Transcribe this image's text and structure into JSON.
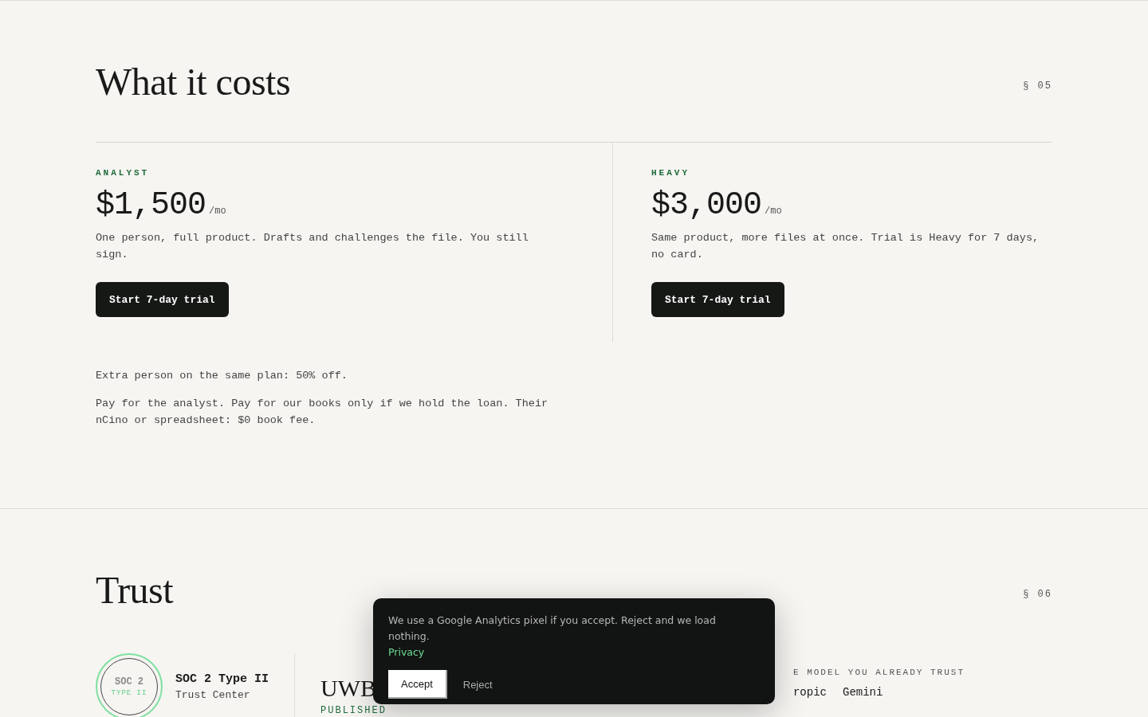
{
  "pricing": {
    "title": "What it costs",
    "section_number": "§ 05",
    "plans": [
      {
        "name": "ANALYST",
        "price": "$1,500",
        "period": "/mo",
        "description": "One person, full product. Drafts and challenges the file. You still sign.",
        "button": "Start 7-day trial"
      },
      {
        "name": "HEAVY",
        "price": "$3,000",
        "period": "/mo",
        "description": "Same product, more files at once. Trial is Heavy for 7 days, no card.",
        "button": "Start 7-day trial"
      }
    ],
    "notes": [
      "Extra person on the same plan: 50% off.",
      "Pay for the analyst. Pay for our books only if we hold the loan. Their nCino or spreadsheet: $0 book fee."
    ]
  },
  "trust": {
    "title": "Trust",
    "section_number": "§ 06",
    "badge": {
      "line_1": "SOC 2",
      "line_2": "TYPE II",
      "title": "SOC 2 Type II",
      "subtitle": "Trust Center"
    },
    "publisher": {
      "name": "UWB",
      "label": "PUBLISHED"
    },
    "models": {
      "label": "E MODEL YOU ALREADY TRUST",
      "items": [
        "ropic",
        "Gemini"
      ]
    }
  },
  "cookie_banner": {
    "text": "We use a Google Analytics pixel if you accept. Reject and we load nothing.",
    "link": "Privacy",
    "buttons": [
      {
        "label": "Accept",
        "kind": "primary"
      },
      {
        "label": "Reject",
        "kind": "plain"
      }
    ]
  }
}
